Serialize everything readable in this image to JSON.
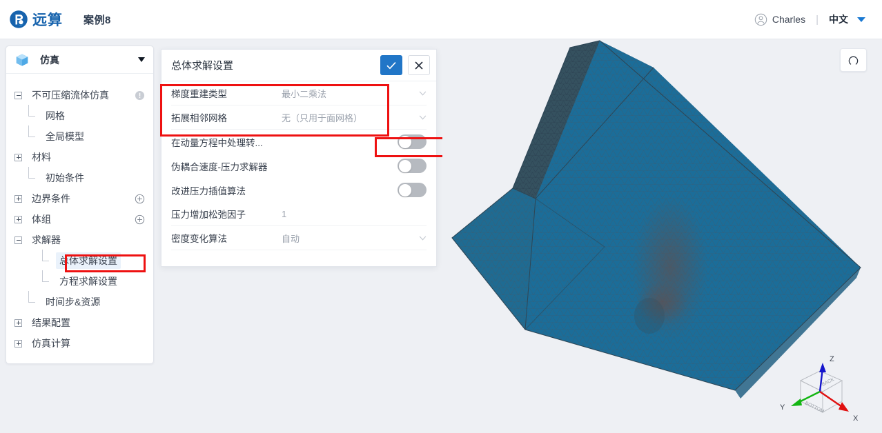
{
  "header": {
    "logo_icon": "yuansuan-logo-icon",
    "brand": "远算",
    "project": "案例8",
    "user_icon": "user-avatar-icon",
    "user": "Charles",
    "separator": "|",
    "language": "中文",
    "caret_icon": "chevron-down-icon"
  },
  "sidebar": {
    "head": {
      "icon": "cube-icon",
      "label": "仿真",
      "caret_icon": "chevron-down-icon"
    },
    "tree": [
      {
        "label": "不可压缩流体仿真",
        "level": 1,
        "toggle": "minus",
        "badge": "info-icon",
        "selected": false
      },
      {
        "label": "网格",
        "level": 2,
        "toggle": "leaf",
        "badge": "",
        "selected": false
      },
      {
        "label": "全局模型",
        "level": 2,
        "toggle": "leaf",
        "badge": "",
        "selected": false
      },
      {
        "label": "材料",
        "level": 1,
        "toggle": "plus",
        "badge": "",
        "selected": false
      },
      {
        "label": "初始条件",
        "level": 2,
        "toggle": "leaf",
        "badge": "",
        "selected": false
      },
      {
        "label": "边界条件",
        "level": 1,
        "toggle": "plus",
        "badge": "add-icon",
        "selected": false
      },
      {
        "label": "体组",
        "level": 1,
        "toggle": "plus",
        "badge": "add-icon",
        "selected": false
      },
      {
        "label": "求解器",
        "level": 1,
        "toggle": "minus",
        "badge": "",
        "selected": false
      },
      {
        "label": "总体求解设置",
        "level": 3,
        "toggle": "leaf",
        "badge": "",
        "selected": true
      },
      {
        "label": "方程求解设置",
        "level": 3,
        "toggle": "leaf",
        "badge": "",
        "selected": false
      },
      {
        "label": "时间步&资源",
        "level": 2,
        "toggle": "leaf",
        "badge": "",
        "selected": false
      },
      {
        "label": "结果配置",
        "level": 1,
        "toggle": "plus",
        "badge": "",
        "selected": false
      },
      {
        "label": "仿真计算",
        "level": 1,
        "toggle": "plus",
        "badge": "",
        "selected": false
      }
    ]
  },
  "panel": {
    "title": "总体求解设置",
    "confirm_icon": "check-icon",
    "cancel_icon": "close-icon",
    "rows": [
      {
        "label": "梯度重建类型",
        "kind": "select",
        "value": "最小二乘法",
        "icon": "chevron-down-icon"
      },
      {
        "label": "拓展相邻网格",
        "kind": "select",
        "value": "无（只用于面网格）",
        "icon": "chevron-down-icon"
      },
      {
        "label": "在动量方程中处理转...",
        "kind": "toggle",
        "value": "off",
        "icon": "toggle-switch-icon"
      },
      {
        "label": "伪耦合速度-压力求解器",
        "kind": "toggle",
        "value": "off",
        "icon": "toggle-switch-icon"
      },
      {
        "label": "改进压力插值算法",
        "kind": "toggle",
        "value": "off",
        "icon": "toggle-switch-icon"
      },
      {
        "label": "压力增加松弛因子",
        "kind": "input",
        "value": "1",
        "icon": ""
      },
      {
        "label": "密度变化算法",
        "kind": "select",
        "value": "自动",
        "icon": "chevron-down-icon"
      }
    ]
  },
  "viewport": {
    "reset_icon": "rotate-reset-icon",
    "model_name": "mesh-box-model",
    "axes": {
      "name": "orientation-axes-gizmo",
      "x_label": "X",
      "y_label": "Y",
      "z_label": "Z",
      "cube_face_back": "BACK",
      "cube_face_bottom": "BOTTOM",
      "x_color": "#e01010",
      "y_color": "#12b512",
      "z_color": "#1515cc"
    }
  },
  "annotations": [
    {
      "name": "highlight-select-fields"
    },
    {
      "name": "highlight-toggle-switch"
    },
    {
      "name": "highlight-tree-selection"
    }
  ],
  "colors": {
    "accent": "#2176c7",
    "brand": "#1763ad",
    "annotation": "#ee1111",
    "canvas": "#eef0f4",
    "mesh_fill": "#1b6d99"
  }
}
